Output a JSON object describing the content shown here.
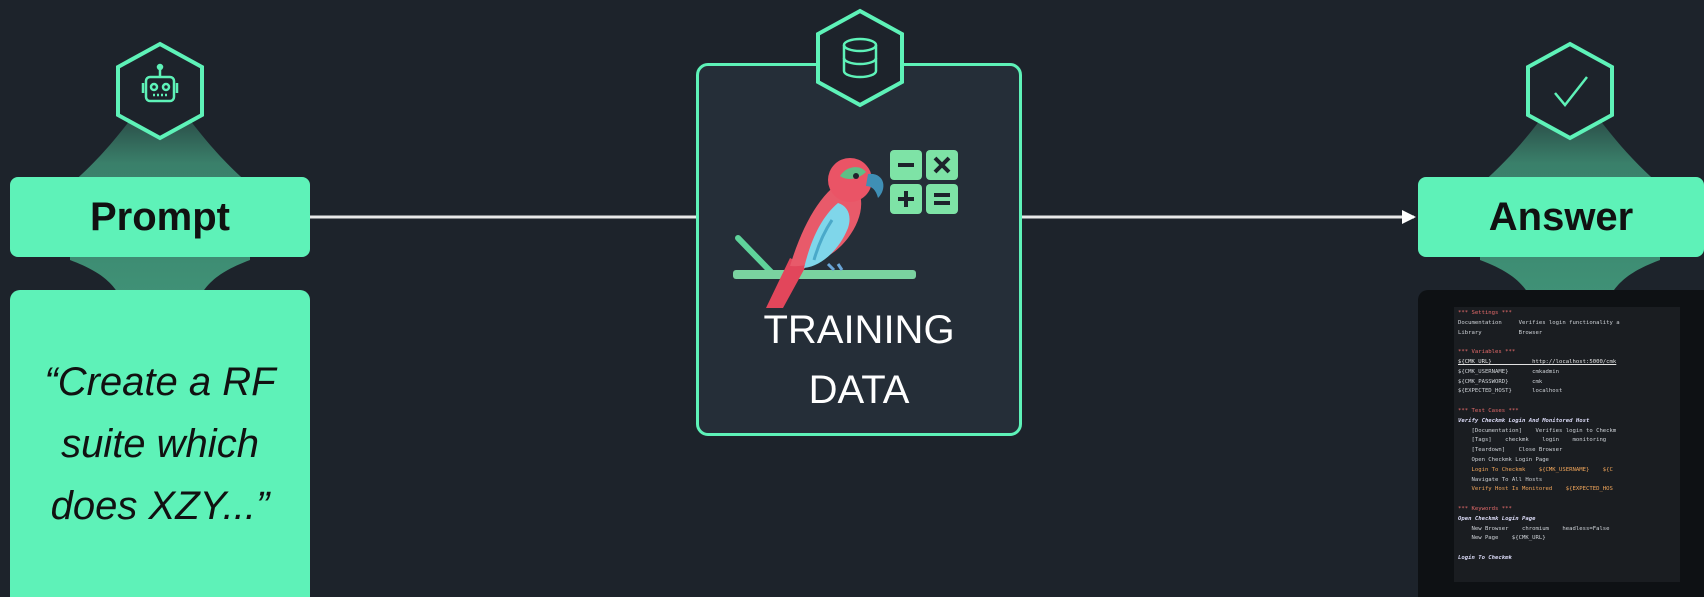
{
  "colors": {
    "background": "#1d232b",
    "accent": "#5ef2b8",
    "box_fill": "#252e38",
    "text_dark": "#111111"
  },
  "prompt": {
    "label": "Prompt",
    "icon": "robot-icon",
    "text": "“Create a RF suite which does XZY...”"
  },
  "training": {
    "label_line1": "TRAINING",
    "label_line2": "DATA",
    "icon": "database-icon",
    "illustration": "parrot-calculator-illustration"
  },
  "answer": {
    "label": "Answer",
    "icon": "checkmark-icon",
    "code_lines": [
      {
        "text": "*** Settings ***",
        "cls": "c-head"
      },
      {
        "text": "Documentation     Verifies login functionality a",
        "cls": ""
      },
      {
        "text": "Library           Browser",
        "cls": ""
      },
      {
        "text": "",
        "cls": ""
      },
      {
        "text": "*** Variables ***",
        "cls": "c-head"
      },
      {
        "text": "${CMK_URL}            http://localhost:5000/cmk",
        "cls": "c-url"
      },
      {
        "text": "${CMK_USERNAME}       cmkadmin",
        "cls": ""
      },
      {
        "text": "${CMK_PASSWORD}       cmk",
        "cls": ""
      },
      {
        "text": "${EXPECTED_HOST}      localhost",
        "cls": ""
      },
      {
        "text": "",
        "cls": ""
      },
      {
        "text": "*** Test Cases ***",
        "cls": "c-head"
      },
      {
        "text": "Verify Checkmk Login And Monitored Host",
        "cls": "c-kw"
      },
      {
        "text": "    [Documentation]    Verifies login to Checkm",
        "cls": ""
      },
      {
        "text": "    [Tags]    checkmk    login    monitoring",
        "cls": ""
      },
      {
        "text": "    [Teardown]    Close Browser",
        "cls": ""
      },
      {
        "text": "    Open Checkmk Login Page",
        "cls": ""
      },
      {
        "text": "    Login To Checkmk    ${CMK_USERNAME}    ${C",
        "cls": "c-var"
      },
      {
        "text": "    Navigate To All Hosts",
        "cls": ""
      },
      {
        "text": "    Verify Host Is Monitored    ${EXPECTED_HOS",
        "cls": "c-var"
      },
      {
        "text": "",
        "cls": ""
      },
      {
        "text": "*** Keywords ***",
        "cls": "c-head"
      },
      {
        "text": "Open Checkmk Login Page",
        "cls": "c-kw"
      },
      {
        "text": "    New Browser    chromium    headless=False",
        "cls": ""
      },
      {
        "text": "    New Page    ${CMK_URL}",
        "cls": ""
      },
      {
        "text": "",
        "cls": ""
      },
      {
        "text": "Login To Checkmk",
        "cls": "c-kw"
      }
    ]
  }
}
